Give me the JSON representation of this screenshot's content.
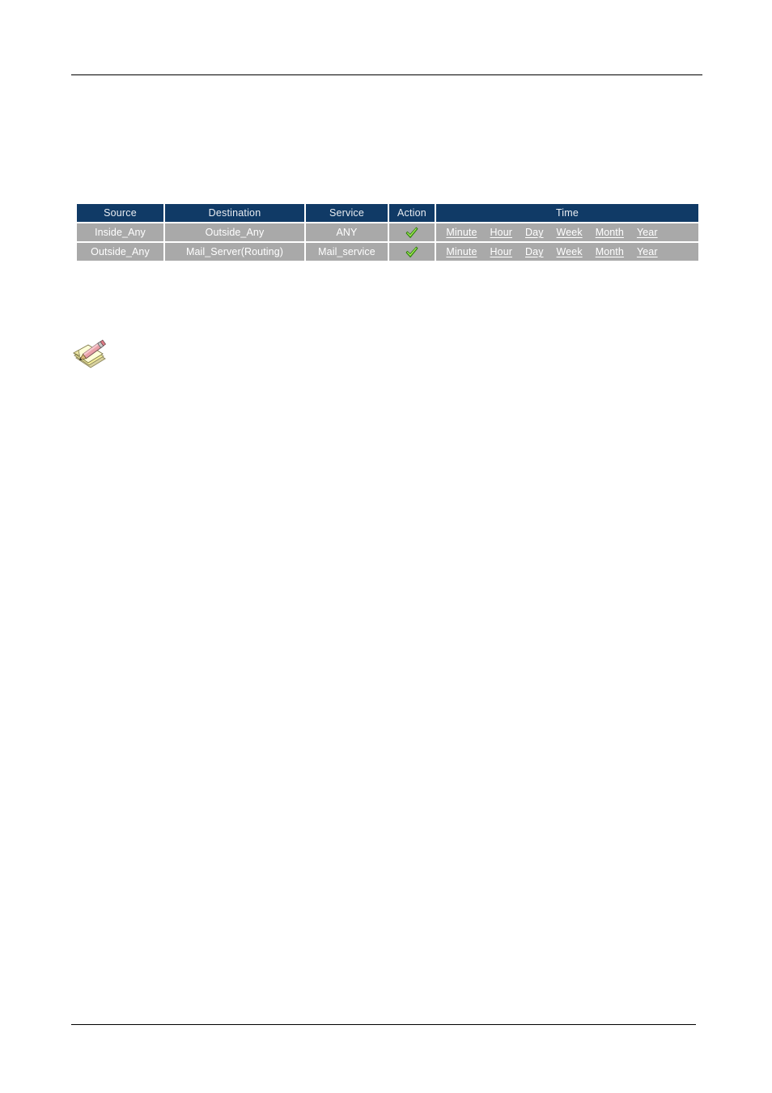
{
  "page": {
    "background": "#ffffff",
    "rule_color": "#000000"
  },
  "policy_table": {
    "header_bg": "#103A66",
    "header_text_color": "#E9EDF2",
    "cell_bg": "#A9A9A9",
    "cell_text_color": "#FFFFFF",
    "columns": [
      {
        "key": "source",
        "label": "Source"
      },
      {
        "key": "destination",
        "label": "Destination"
      },
      {
        "key": "service",
        "label": "Service"
      },
      {
        "key": "action",
        "label": "Action"
      },
      {
        "key": "time",
        "label": "Time"
      }
    ],
    "time_links": [
      "Minute",
      "Hour",
      "Day",
      "Week",
      "Month",
      "Year"
    ],
    "action_icon": {
      "name": "green-check-icon",
      "fill": "#7DE02B",
      "stroke": "#2E7D0E",
      "highlight": "#B6F06B"
    },
    "rows": [
      {
        "source": "Inside_Any",
        "destination": "Outside_Any",
        "service": "ANY",
        "action": "permit",
        "time": [
          "Minute",
          "Hour",
          "Day",
          "Week",
          "Month",
          "Year"
        ]
      },
      {
        "source": "Outside_Any",
        "destination": "Mail_Server(Routing)",
        "service": "Mail_service",
        "action": "permit",
        "time": [
          "Minute",
          "Hour",
          "Day",
          "Week",
          "Month",
          "Year"
        ]
      }
    ]
  },
  "note": {
    "icon": "note-pencil-icon",
    "paper_fill": "#FFFFC6",
    "paper_shadow": "#E8E08A",
    "pencil_body": "#E8A0A8",
    "pencil_tip": "#C8A060"
  }
}
